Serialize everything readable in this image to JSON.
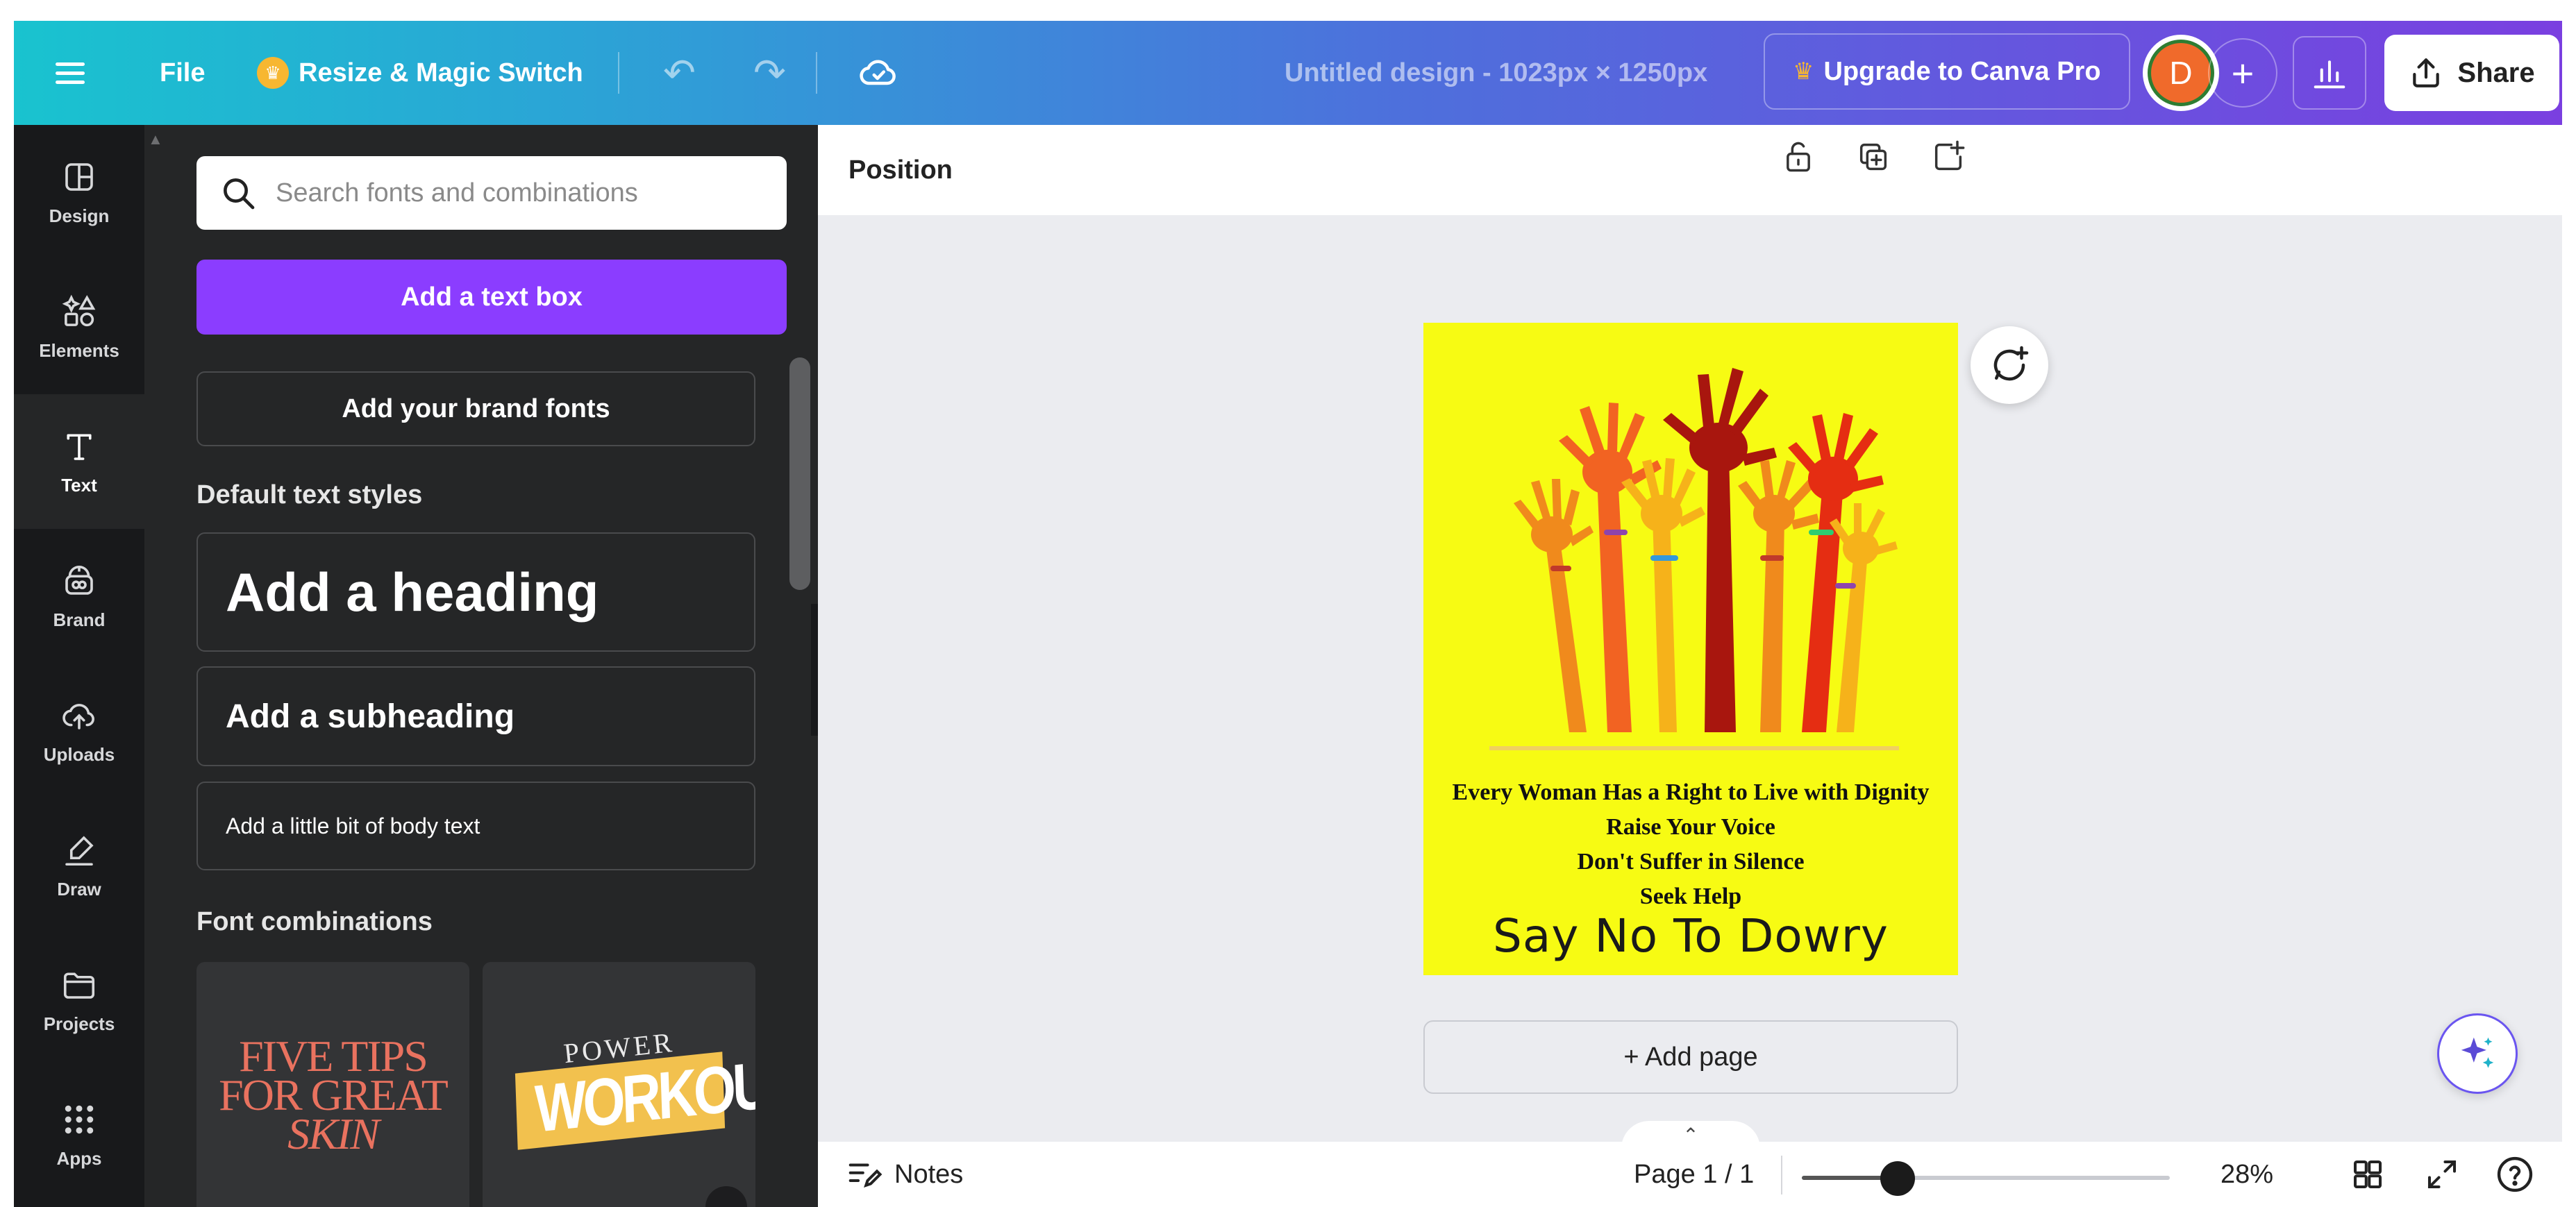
{
  "topbar": {
    "file_label": "File",
    "resize_label": "Resize & Magic Switch",
    "design_title": "Untitled design - 1023px × 1250px",
    "upgrade_label": "Upgrade to Canva Pro",
    "avatar_initial": "D",
    "share_label": "Share",
    "gradient_colors": [
      "#19c3cf",
      "#4e6fdc",
      "#7a3fe0"
    ]
  },
  "rail": {
    "items": [
      {
        "label": "Design",
        "icon": "layout-icon"
      },
      {
        "label": "Elements",
        "icon": "shapes-icon"
      },
      {
        "label": "Text",
        "icon": "text-icon"
      },
      {
        "label": "Brand",
        "icon": "brand-icon"
      },
      {
        "label": "Uploads",
        "icon": "upload-cloud-icon"
      },
      {
        "label": "Draw",
        "icon": "pen-icon"
      },
      {
        "label": "Projects",
        "icon": "folder-icon"
      },
      {
        "label": "Apps",
        "icon": "grid-icon"
      }
    ],
    "active": "Text"
  },
  "panel": {
    "search_placeholder": "Search fonts and combinations",
    "add_text_box": "Add a text box",
    "add_brand_fonts": "Add your brand fonts",
    "default_styles_title": "Default text styles",
    "heading": "Add a heading",
    "subheading": "Add a subheading",
    "body": "Add a little bit of body text",
    "font_combinations_title": "Font combinations",
    "combo1_text": [
      "FIVE TIPS",
      "FOR GREAT",
      "SKIN"
    ],
    "combo2_top": "POWER",
    "combo2_main": "WORKOUT",
    "accent_color": "#8b3dff"
  },
  "workspace": {
    "position_label": "Position",
    "add_page_label": "+ Add page",
    "design": {
      "background_color": "#f7fb13",
      "lines": [
        "Every Woman Has a Right to Live with Dignity",
        "Raise Your Voice",
        "Don't Suffer in Silence",
        "Seek Help"
      ],
      "headline": "Say No To Dowry"
    }
  },
  "bottombar": {
    "notes_label": "Notes",
    "page_indicator": "Page 1 / 1",
    "zoom_label": "28%",
    "zoom_value": 0.28
  }
}
